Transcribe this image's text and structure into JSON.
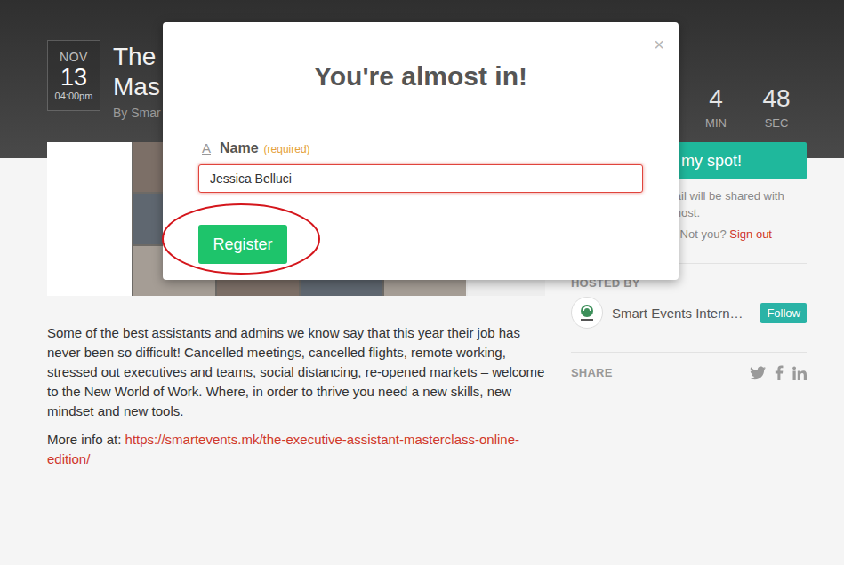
{
  "event": {
    "month": "NOV",
    "day": "13",
    "time": "04:00pm",
    "title_lines": [
      "The",
      "Mas"
    ],
    "byline": "By Smar"
  },
  "countdown": [
    {
      "value": "4",
      "unit": "MIN"
    },
    {
      "value": "48",
      "unit": "SEC"
    }
  ],
  "description": "Some of the best assistants and admins we know say that this year their job has never been so difficult! Cancelled meetings, cancelled flights, remote working, stressed out executives and teams, social distancing, re-opened markets – welcome to the New World of Work. Where, in order to thrive you need a new skills, new mindset and new tools.",
  "more_info": {
    "label": "More info at: ",
    "link": "https://smartevents.mk/the-executive-assistant-masterclass-online-edition/"
  },
  "sidebar": {
    "reserve_button": "my spot!",
    "notice_lines": [
      "mail will be shared with",
      "e host."
    ],
    "user_line": "ci! Not you? ",
    "sign_out": "Sign out",
    "hosted_by": "HOSTED BY",
    "host_name": "Smart Events Intern…",
    "follow": "Follow",
    "share": "SHARE"
  },
  "modal": {
    "close": "×",
    "title": "You're almost in!",
    "field": {
      "icon": "A",
      "label": "Name",
      "hint": "(required)",
      "value": "Jessica Belluci",
      "invalid": true
    },
    "button": "Register"
  }
}
